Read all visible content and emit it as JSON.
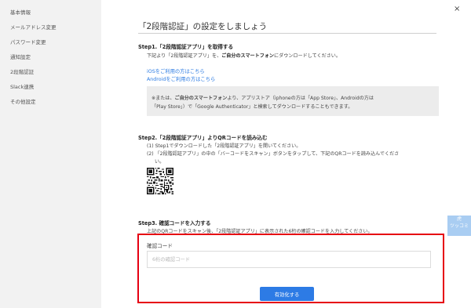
{
  "sidebar": {
    "items": [
      {
        "label": "基本情報"
      },
      {
        "label": "メールアドレス変更"
      },
      {
        "label": "パスワード変更"
      },
      {
        "label": "通知設定"
      },
      {
        "label": "2段階認証"
      },
      {
        "label": "Slack連携"
      },
      {
        "label": "その他設定"
      }
    ]
  },
  "close_label": "×",
  "title": "「2段階認証」の設定をしましょう",
  "step1": {
    "heading": "Step1.「2段階認証アプリ」を取得する",
    "desc_prefix": "下記より「2段階認証アプリ」を、",
    "desc_bold": "ご自分のスマートフォン",
    "desc_suffix": "にダウンロードしてください。",
    "link_ios": "iOSをご利用の方はこちら",
    "link_android": "Androidをご利用の方はこちら",
    "note_prefix": "※または、",
    "note_bold": "ご自分のスマートフォン",
    "note_rest": "より、アプリストア（iphoneの方は「App Store」、Androidの方は",
    "note_line2": "「Play Store」）で「Google Authenticator」と検索してダウンロードすることもできます。"
  },
  "step2": {
    "heading": "Step2.「2段階認証アプリ」よりQRコードを読み込む",
    "line1": "(1) Step1でダウンロードした「2段階認証アプリ」を開いてください。",
    "line2": "(2) 「2段階認証アプリ」の中の「バーコードをスキャン」ボタンをタップして、下記のQRコードを読み込んでくださ",
    "line3": "い。"
  },
  "step3": {
    "heading": "Step3. 確認コードを入力する",
    "desc": "上記のQRコードをスキャン後、「2段階認証アプリ」に表示された6桁の確認コードを入力してください。",
    "field_label": "確認コード",
    "placeholder": "6桁の確認コード",
    "value": "",
    "button": "有効化する"
  },
  "side_tab": {
    "line1": "虎",
    "line2": "ツッコミ"
  },
  "colors": {
    "link": "#2a7ae2",
    "button": "#2d7be5",
    "highlight_border": "#e60012",
    "side_tab": "#a9cdf2"
  }
}
